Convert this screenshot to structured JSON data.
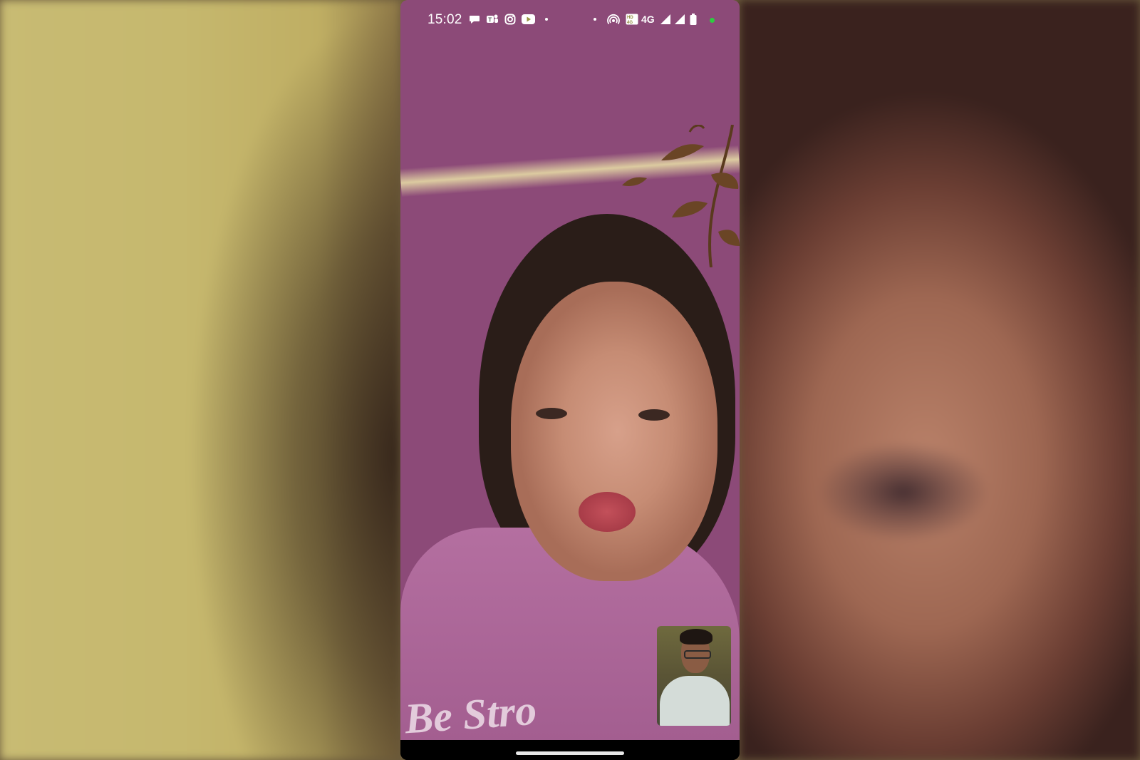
{
  "status_bar": {
    "time": "15:02",
    "network": "4G",
    "icons": [
      "chat-bubble-icon",
      "teams-icon",
      "instagram-icon",
      "youtube-icon",
      "dot-icon",
      "dot-icon",
      "hotspot-icon",
      "volte-icon",
      "signal-icon",
      "signal-icon",
      "battery-icon"
    ],
    "active_indicator_color": "#2ecc40"
  },
  "call": {
    "shirt_text": "Be Stro"
  },
  "colors": {
    "wall": "#b4ad55",
    "shirt": "#a35e90"
  }
}
